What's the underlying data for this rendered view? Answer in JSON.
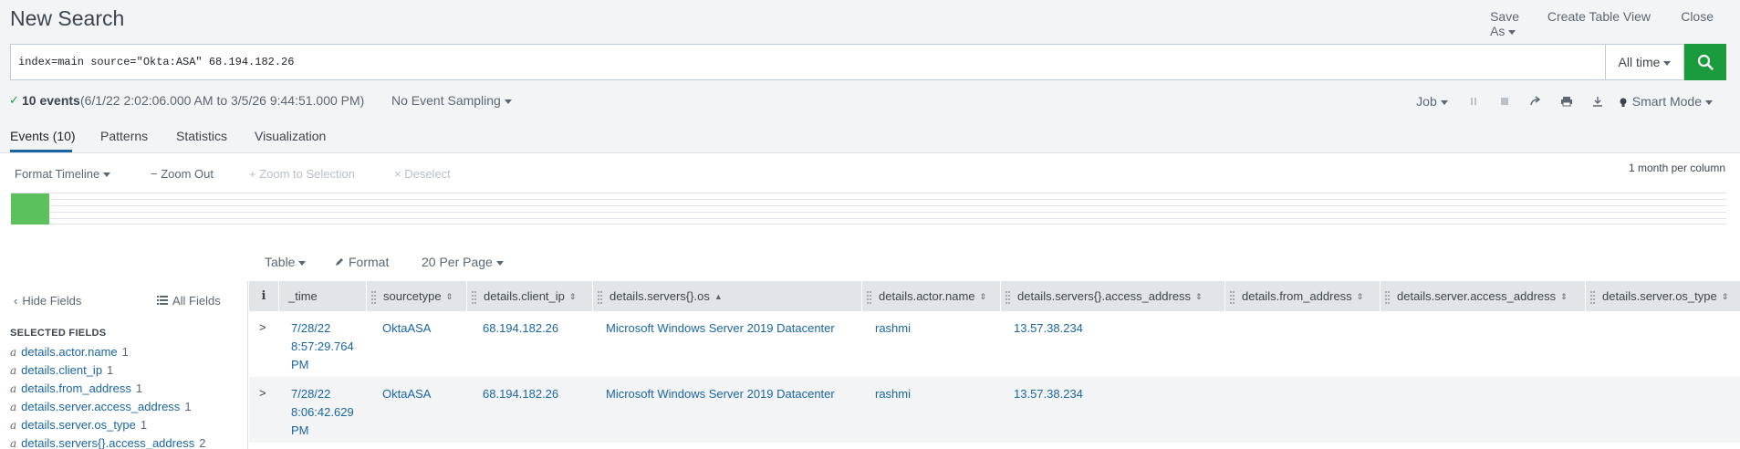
{
  "header": {
    "title": "New Search",
    "actions": {
      "save_as": "Save As",
      "create_table_view": "Create Table View",
      "close": "Close"
    }
  },
  "search": {
    "query": "index=main source=\"Okta:ASA\" 68.194.182.26",
    "time_range": "All time"
  },
  "status": {
    "check": "✓",
    "count": "10 events",
    "range": "(6/1/22 2:02:06.000 AM to 3/5/26 9:44:51.000 PM)",
    "sampling": "No Event Sampling",
    "job": "Job",
    "mode": "Smart Mode"
  },
  "tabs": [
    {
      "label": "Events (10)",
      "active": true
    },
    {
      "label": "Patterns"
    },
    {
      "label": "Statistics"
    },
    {
      "label": "Visualization"
    }
  ],
  "timeline": {
    "format": "Format Timeline",
    "zoom_out": "− Zoom Out",
    "zoom_selection": "+ Zoom to Selection",
    "deselect": "× Deselect",
    "scale": "1 month per column",
    "bar_color": "#5cc05c"
  },
  "table_controls": {
    "table": "Table",
    "format": "Format",
    "per_page": "20 Per Page"
  },
  "sidebar": {
    "hide_fields": "Hide Fields",
    "all_fields": "All Fields",
    "selected_title": "SELECTED FIELDS",
    "fields": [
      {
        "type": "a",
        "name": "details.actor.name",
        "count": "1"
      },
      {
        "type": "a",
        "name": "details.client_ip",
        "count": "1"
      },
      {
        "type": "a",
        "name": "details.from_address",
        "count": "1"
      },
      {
        "type": "a",
        "name": "details.server.access_address",
        "count": "1"
      },
      {
        "type": "a",
        "name": "details.server.os_type",
        "count": "1"
      },
      {
        "type": "a",
        "name": "details.servers{}.access_address",
        "count": "2"
      }
    ]
  },
  "grid": {
    "info_header": "i",
    "columns": [
      "_time",
      "sourcetype",
      "details.client_ip",
      "details.servers{}.os",
      "details.actor.name",
      "details.servers{}.access_address",
      "details.from_address",
      "details.server.access_address",
      "details.server.os_type"
    ],
    "rows": [
      {
        "time_l1": "7/28/22",
        "time_l2": "8:57:29.764",
        "time_l3": "PM",
        "sourcetype": "OktaASA",
        "client_ip": "68.194.182.26",
        "os": "Microsoft Windows Server 2019 Datacenter",
        "actor": "rashmi",
        "access_address": "13.57.38.234"
      },
      {
        "time_l1": "7/28/22",
        "time_l2": "8:06:42.629",
        "time_l3": "PM",
        "sourcetype": "OktaASA",
        "client_ip": "68.194.182.26",
        "os": "Microsoft Windows Server 2019 Datacenter",
        "actor": "rashmi",
        "access_address": "13.57.38.234"
      }
    ]
  }
}
